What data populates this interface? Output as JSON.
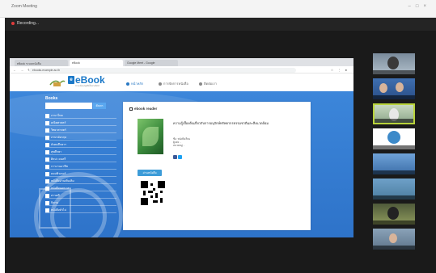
{
  "window": {
    "title": "Zoom Meeting"
  },
  "meeting": {
    "recording_label": "Recording..."
  },
  "browser": {
    "tabs": [
      {
        "label": "eBook ระบบหนังสือ"
      },
      {
        "label": "eBook"
      },
      {
        "label": "Google Meet - Google"
      }
    ],
    "address": "ebooks.example.ac.th",
    "nav_icons": "← → ↻",
    "ext_icons": "☆ ⋮ ●"
  },
  "site": {
    "logo_text": "eBook",
    "logo_sub": "ระบบห้องสมุดอิเล็กทรอนิกส์",
    "menu": [
      {
        "label": "หน้าหลัก"
      },
      {
        "label": "การจัดการหนังสือ"
      },
      {
        "label": "ติดต่อเรา"
      }
    ]
  },
  "sidebar": {
    "title": "Books",
    "search_placeholder": "",
    "search_button": "ค้นหา",
    "items": [
      {
        "label": "ภาษาไทย"
      },
      {
        "label": "คณิตศาสตร์"
      },
      {
        "label": "วิทยาศาสตร์"
      },
      {
        "label": "ภาษาอังกฤษ"
      },
      {
        "label": "สังคมศึกษาฯ"
      },
      {
        "label": "สุขศึกษา"
      },
      {
        "label": "ศิลปะ ดนตรี"
      },
      {
        "label": "การงานอาชีพ"
      },
      {
        "label": "คอมพิวเตอร์"
      },
      {
        "label": "หนังสืออ่านเพิ่มเติม"
      },
      {
        "label": "หนังสือนอกเวลา"
      },
      {
        "label": "สารคดี"
      },
      {
        "label": "นิทาน"
      },
      {
        "label": "หนังสือทั่วไป"
      }
    ]
  },
  "card": {
    "title": "ebook reader",
    "description": "ความรู้เบื้องต้นเกี่ยวกับการอนุรักษ์ทรัพยากรธรรมชาติและสิ่งแวดล้อม",
    "meta": [
      "ชื่อ: หนังสือเรียน",
      "ผู้แต่ง: -",
      "หมวดหมู่: -"
    ],
    "read_button": "อ่านหนังสือ"
  },
  "participants": [
    {
      "name": ""
    },
    {
      "name": ""
    },
    {
      "name": ""
    },
    {
      "name": ""
    },
    {
      "name": ""
    },
    {
      "name": ""
    },
    {
      "name": ""
    },
    {
      "name": ""
    }
  ],
  "colors": {
    "brand": "#1a78c8",
    "page_blue": "#3c86da",
    "meeting_bg": "#1a1a1a"
  }
}
